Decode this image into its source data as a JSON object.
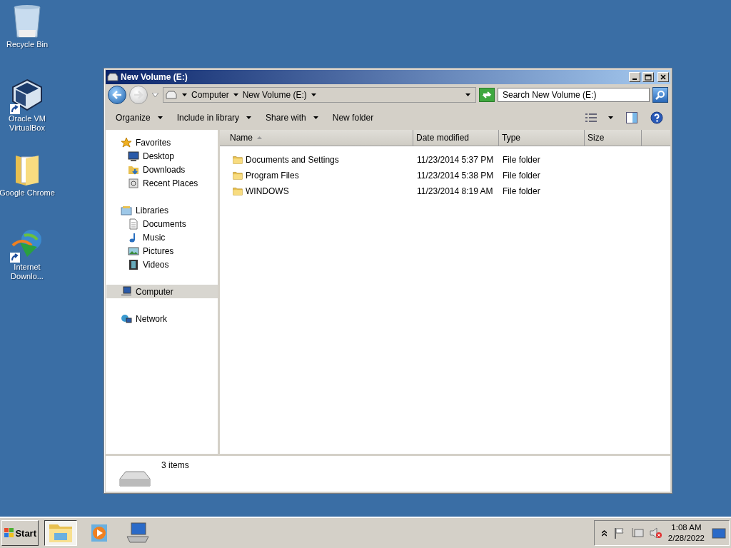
{
  "desktop_icons": [
    {
      "label": "Recycle Bin",
      "kind": "recycle",
      "shortcut": false
    },
    {
      "label": "Oracle VM VirtualBox",
      "kind": "cube",
      "shortcut": true
    },
    {
      "label": "Google Chrome",
      "kind": "folder",
      "shortcut": false
    },
    {
      "label": "Internet Downlo...",
      "kind": "globe",
      "shortcut": true
    }
  ],
  "window": {
    "title": "New Volume (E:)",
    "nav": {
      "back_disabled": false,
      "forward_disabled": true
    },
    "breadcrumbs": [
      "Computer",
      "New Volume (E:)"
    ],
    "search": {
      "placeholder": "Search New Volume (E:)"
    },
    "toolbar": [
      {
        "label": "Organize",
        "dropdown": true
      },
      {
        "label": "Include in library",
        "dropdown": true
      },
      {
        "label": "Share with",
        "dropdown": true
      },
      {
        "label": "New folder",
        "dropdown": false
      }
    ],
    "sidebar": [
      {
        "label": "Favorites",
        "kind": "star",
        "selected": false,
        "children": [
          {
            "label": "Desktop",
            "kind": "desktop",
            "selected": false
          },
          {
            "label": "Downloads",
            "kind": "downloads",
            "selected": false
          },
          {
            "label": "Recent Places",
            "kind": "recent",
            "selected": false
          }
        ]
      },
      {
        "label": "Libraries",
        "kind": "library",
        "selected": false,
        "children": [
          {
            "label": "Documents",
            "kind": "document",
            "selected": false
          },
          {
            "label": "Music",
            "kind": "music",
            "selected": false
          },
          {
            "label": "Pictures",
            "kind": "pictures",
            "selected": false
          },
          {
            "label": "Videos",
            "kind": "videos",
            "selected": false
          }
        ]
      },
      {
        "label": "Computer",
        "kind": "computer",
        "selected": true
      },
      {
        "label": "Network",
        "kind": "network",
        "selected": false
      }
    ],
    "table": {
      "columns": [
        {
          "label": "Name",
          "sorted": true
        },
        {
          "label": "Date modified",
          "sorted": false
        },
        {
          "label": "Type",
          "sorted": false
        },
        {
          "label": "Size",
          "sorted": false
        }
      ],
      "rows": [
        {
          "name": "Documents and Settings",
          "date_modified": "11/23/2014 5:37 PM",
          "type": "File folder"
        },
        {
          "name": "Program Files",
          "date_modified": "11/23/2014 5:38 PM",
          "type": "File folder"
        },
        {
          "name": "WINDOWS",
          "date_modified": "11/23/2014 8:19 AM",
          "type": "File folder"
        }
      ]
    },
    "status": "3 items"
  },
  "taskbar": {
    "start": "Start",
    "apps": [
      {
        "kind": "explorer",
        "selected": true
      },
      {
        "kind": "media",
        "selected": false
      },
      {
        "kind": "computer",
        "selected": false
      }
    ],
    "tray": {
      "volume_muted": true
    },
    "time": "1:08 AM",
    "date": "2/28/2022"
  }
}
